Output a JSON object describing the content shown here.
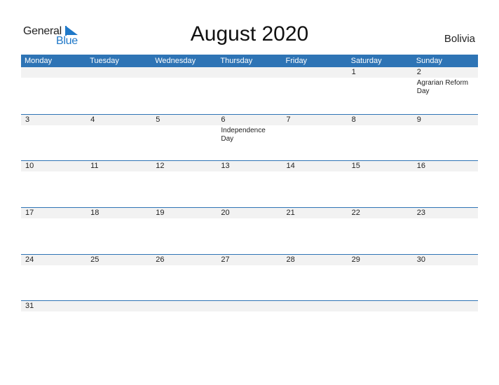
{
  "logo": {
    "line1": "General",
    "line2": "Blue"
  },
  "title": "August 2020",
  "country": "Bolivia",
  "colors": {
    "accent": "#2e74b5",
    "band": "#f2f2f2",
    "logo_blue": "#1f78c8"
  },
  "weekdays": [
    "Monday",
    "Tuesday",
    "Wednesday",
    "Thursday",
    "Friday",
    "Saturday",
    "Sunday"
  ],
  "weeks": [
    {
      "days": [
        {
          "num": "",
          "event": ""
        },
        {
          "num": "",
          "event": ""
        },
        {
          "num": "",
          "event": ""
        },
        {
          "num": "",
          "event": ""
        },
        {
          "num": "",
          "event": ""
        },
        {
          "num": "1",
          "event": ""
        },
        {
          "num": "2",
          "event": "Agrarian Reform Day"
        }
      ]
    },
    {
      "days": [
        {
          "num": "3",
          "event": ""
        },
        {
          "num": "4",
          "event": ""
        },
        {
          "num": "5",
          "event": ""
        },
        {
          "num": "6",
          "event": "Independence Day"
        },
        {
          "num": "7",
          "event": ""
        },
        {
          "num": "8",
          "event": ""
        },
        {
          "num": "9",
          "event": ""
        }
      ]
    },
    {
      "days": [
        {
          "num": "10",
          "event": ""
        },
        {
          "num": "11",
          "event": ""
        },
        {
          "num": "12",
          "event": ""
        },
        {
          "num": "13",
          "event": ""
        },
        {
          "num": "14",
          "event": ""
        },
        {
          "num": "15",
          "event": ""
        },
        {
          "num": "16",
          "event": ""
        }
      ]
    },
    {
      "days": [
        {
          "num": "17",
          "event": ""
        },
        {
          "num": "18",
          "event": ""
        },
        {
          "num": "19",
          "event": ""
        },
        {
          "num": "20",
          "event": ""
        },
        {
          "num": "21",
          "event": ""
        },
        {
          "num": "22",
          "event": ""
        },
        {
          "num": "23",
          "event": ""
        }
      ]
    },
    {
      "days": [
        {
          "num": "24",
          "event": ""
        },
        {
          "num": "25",
          "event": ""
        },
        {
          "num": "26",
          "event": ""
        },
        {
          "num": "27",
          "event": ""
        },
        {
          "num": "28",
          "event": ""
        },
        {
          "num": "29",
          "event": ""
        },
        {
          "num": "30",
          "event": ""
        }
      ]
    },
    {
      "days": [
        {
          "num": "31",
          "event": ""
        },
        {
          "num": "",
          "event": ""
        },
        {
          "num": "",
          "event": ""
        },
        {
          "num": "",
          "event": ""
        },
        {
          "num": "",
          "event": ""
        },
        {
          "num": "",
          "event": ""
        },
        {
          "num": "",
          "event": ""
        }
      ]
    }
  ]
}
